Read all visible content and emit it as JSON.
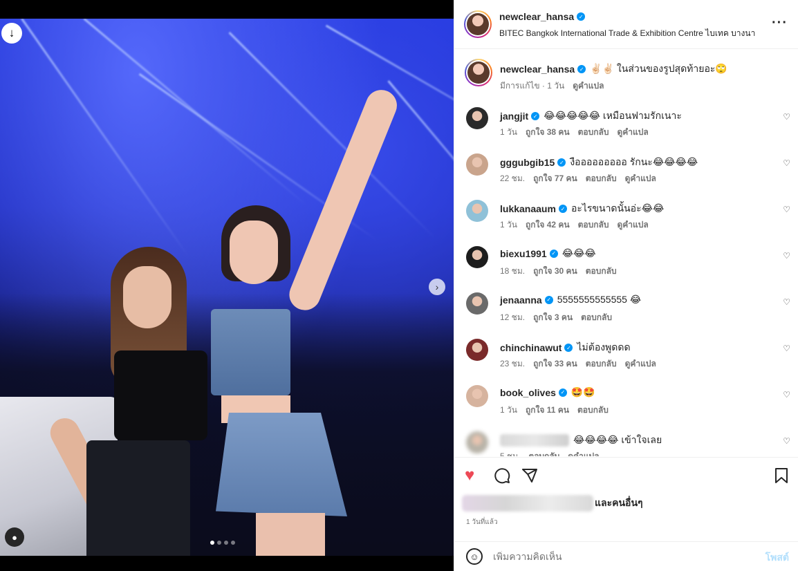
{
  "post": {
    "username": "newclear_hansa",
    "location": "BITEC Bangkok International Trade & Exhibition Centre ไบเทค บางนา",
    "caption": "✌🏻✌🏻 ในส่วนของรูปสุดท้ายอะ🙄",
    "caption_meta": "มีการแก้ไข · 1 วัน",
    "translate": "ดูคำแปล"
  },
  "comments": [
    {
      "user": "jangjit",
      "text": "😂😂😂😂😂 เหมือนฟามรักเนาะ",
      "time": "1 วัน",
      "likes": "ถูกใจ 38 คน",
      "reply": "ตอบกลับ",
      "translate": "ดูคำแปล",
      "avatar_color": "#2a2a2a"
    },
    {
      "user": "gggubgib15",
      "text": "งือออออออออ รักนะ😂😂😂😂",
      "time": "22 ชม.",
      "likes": "ถูกใจ 77 คน",
      "reply": "ตอบกลับ",
      "translate": "ดูคำแปล",
      "avatar_color": "#c9a48c"
    },
    {
      "user": "lukkanaaum",
      "text": "อะไรขนาดนั้นอ่ะ😂😂",
      "time": "1 วัน",
      "likes": "ถูกใจ 42 คน",
      "reply": "ตอบกลับ",
      "translate": "ดูคำแปล",
      "avatar_color": "#8fc1d8"
    },
    {
      "user": "biexu1991",
      "text": "😂😂😂",
      "time": "18 ชม.",
      "likes": "ถูกใจ 30 คน",
      "reply": "ตอบกลับ",
      "translate": "",
      "avatar_color": "#1d1d1d"
    },
    {
      "user": "jenaanna",
      "text": "5555555555555 😂",
      "time": "12 ชม.",
      "likes": "ถูกใจ 3 คน",
      "reply": "ตอบกลับ",
      "translate": "",
      "avatar_color": "#6a6a6a"
    },
    {
      "user": "chinchinawut",
      "text": "ไม่ต้องพูดดด",
      "time": "23 ชม.",
      "likes": "ถูกใจ 33 คน",
      "reply": "ตอบกลับ",
      "translate": "ดูคำแปล",
      "avatar_color": "#7a2a2a"
    },
    {
      "user": "book_olives",
      "text": "🤩🤩",
      "time": "1 วัน",
      "likes": "ถูกใจ 11 คน",
      "reply": "ตอบกลับ",
      "translate": "",
      "avatar_color": "#d6b39e"
    },
    {
      "user": "",
      "text": "😂😂😂😂 เข้าใจเลย",
      "time": "5 ชม.",
      "likes": "",
      "reply": "ตอบกลับ",
      "translate": "ดูคำแปล",
      "avatar_color": "#b8b3a8"
    }
  ],
  "likes_suffix": "และคนอื่นๆ",
  "posted_time": "1 วันที่แล้ว",
  "composer": {
    "placeholder": "เพิ่มความคิดเห็น",
    "post_label": "โพสต์"
  },
  "icons": {
    "download": "download-icon",
    "next": "chevron-right-icon",
    "user": "user-icon",
    "like": "heart-filled-icon",
    "comment": "comment-icon",
    "share": "send-icon",
    "save": "bookmark-icon",
    "more": "more-horizontal-icon",
    "emoji": "emoji-icon"
  },
  "colors": {
    "like": "#ed4956",
    "verified": "#0095f6",
    "post_disabled": "#b2dffc"
  },
  "carousel": {
    "count": 4,
    "active": 1
  }
}
